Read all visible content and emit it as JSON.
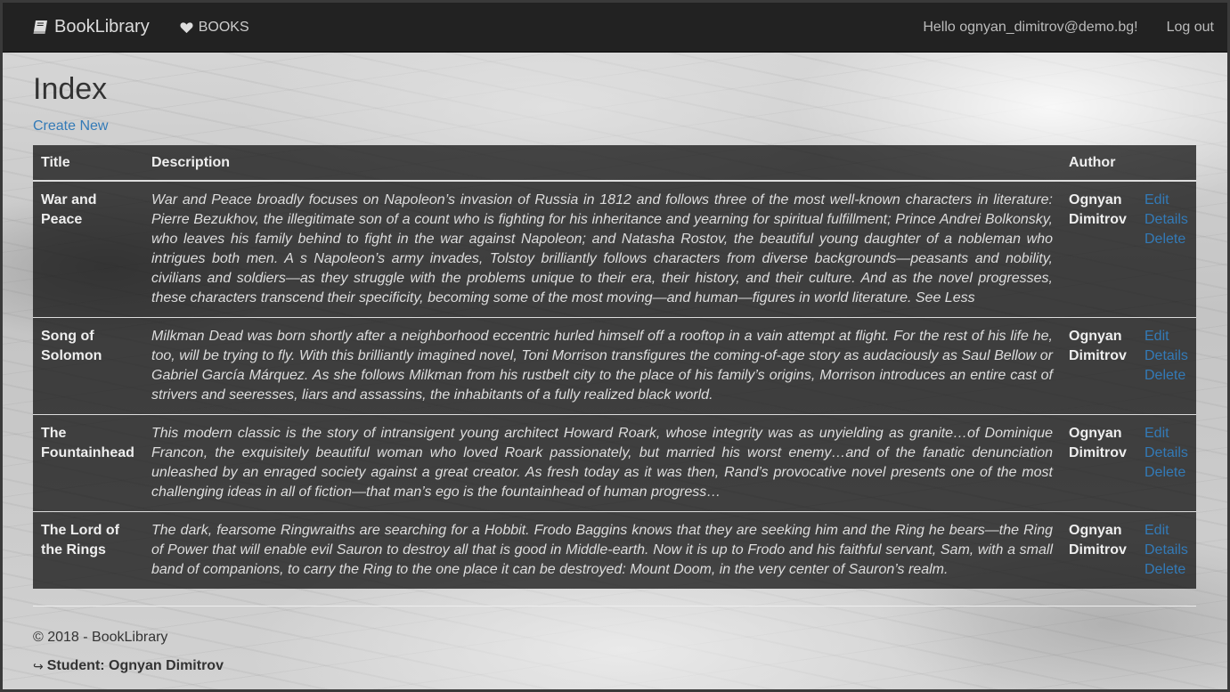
{
  "nav": {
    "brand": "BookLibrary",
    "books": "BOOKS",
    "hello": "Hello ognyan_dimitrov@demo.bg!",
    "logout": "Log out"
  },
  "page": {
    "title": "Index",
    "create_new": "Create New"
  },
  "table": {
    "headers": [
      "Title",
      "Description",
      "Author"
    ],
    "rows": [
      {
        "title": "War and Peace",
        "description": "War and Peace broadly focuses on Napoleon’s invasion of Russia in 1812 and follows three of the most well-known characters in literature: Pierre Bezukhov, the illegitimate son of a count who is fighting for his inheritance and yearning for spiritual fulfillment; Prince Andrei Bolkonsky, who leaves his family behind to fight in the war against Napoleon; and Natasha Rostov, the beautiful young daughter of a nobleman who intrigues both men. A s Napoleon’s army invades, Tolstoy brilliantly follows characters from diverse backgrounds—peasants and nobility, civilians and soldiers—as they struggle with the problems unique to their era, their history, and their culture. And as the novel progresses, these characters transcend their specificity, becoming some of the most moving—and human—figures in world literature. See Less",
        "author": "Ognyan Dimitrov",
        "edit": "Edit",
        "details": "Details",
        "delete": "Delete"
      },
      {
        "title": "Song of Solomon",
        "description": "Milkman Dead was born shortly after a neighborhood eccentric hurled himself off a rooftop in a vain attempt at flight. For the rest of his life he, too, will be trying to fly. With this brilliantly imagined novel, Toni Morrison transfigures the coming-of-age story as audaciously as Saul Bellow or Gabriel García Márquez. As she follows Milkman from his rustbelt city to the place of his family’s origins, Morrison introduces an entire cast of strivers and seeresses, liars and assassins, the inhabitants of a fully realized black world.",
        "author": "Ognyan Dimitrov",
        "edit": "Edit",
        "details": "Details",
        "delete": "Delete"
      },
      {
        "title": "The Fountainhead",
        "description": "This modern classic is the story of intransigent young architect Howard Roark, whose integrity was as unyielding as granite…of Dominique Francon, the exquisitely beautiful woman who loved Roark passionately, but married his worst enemy…and of the fanatic denunciation unleashed by an enraged society against a great creator. As fresh today as it was then, Rand’s provocative novel presents one of the most challenging ideas in all of fiction—that man’s ego is the fountainhead of human progress…",
        "author": "Ognyan Dimitrov",
        "edit": "Edit",
        "details": "Details",
        "delete": "Delete"
      },
      {
        "title": "The Lord of the Rings",
        "description": "The dark, fearsome Ringwraiths are searching for a Hobbit. Frodo Baggins knows that they are seeking him and the Ring he bears—the Ring of Power that will enable evil Sauron to destroy all that is good in Middle-earth. Now it is up to Frodo and his faithful servant, Sam, with a small band of companions, to carry the Ring to the one place it can be destroyed: Mount Doom, in the very center of Sauron’s realm.",
        "author": "Ognyan Dimitrov",
        "edit": "Edit",
        "details": "Details",
        "delete": "Delete"
      }
    ]
  },
  "footer": {
    "copyright": "© 2018 - BookLibrary",
    "student": "Student: Ognyan Dimitrov"
  },
  "icons": {
    "brand": "book-icon",
    "books": "heart-icon",
    "student": "arrow-icon"
  },
  "colors": {
    "navbar": "#222222",
    "link": "#337ab7"
  }
}
